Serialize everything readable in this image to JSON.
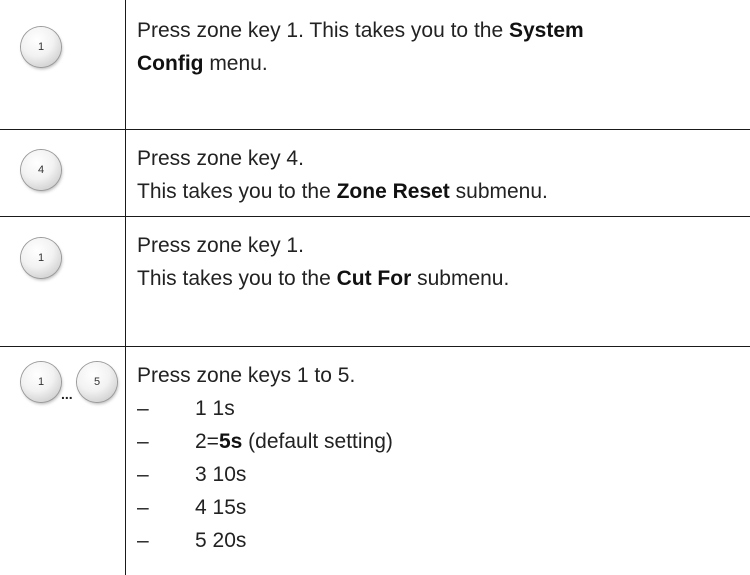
{
  "rows": [
    {
      "key": "1",
      "parts": [
        "Press zone key 1. This takes you to the ",
        "System",
        " ",
        "Config",
        " menu."
      ]
    },
    {
      "key": "4",
      "line1": "Press zone key 4.",
      "line2_pre": "This takes you to the ",
      "line2_bold": "Zone Reset",
      "line2_post": " submenu."
    },
    {
      "key": "1",
      "line1": "Press zone key 1.",
      "line2_pre": "This takes you to the ",
      "line2_bold": "Cut For",
      "line2_post": " submenu."
    },
    {
      "key_start": "1",
      "ellipsis": "...",
      "key_end": "5",
      "line1": "Press zone keys 1 to 5.",
      "dash": "–",
      "bullets": [
        {
          "text": "1 1s"
        },
        {
          "pre": "2=",
          "bold": "5s",
          "post": " (default setting)"
        },
        {
          "text": "3 10s"
        },
        {
          "text": "4 15s"
        },
        {
          "text": "5 20s"
        }
      ]
    }
  ]
}
